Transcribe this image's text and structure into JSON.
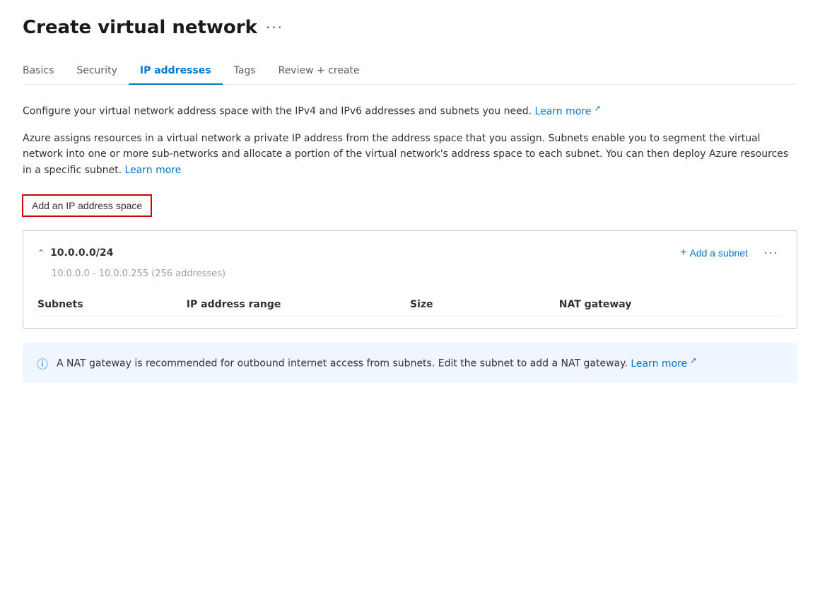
{
  "page": {
    "title": "Create virtual network",
    "more_label": "···"
  },
  "tabs": [
    {
      "id": "basics",
      "label": "Basics",
      "active": false
    },
    {
      "id": "security",
      "label": "Security",
      "active": false
    },
    {
      "id": "ip-addresses",
      "label": "IP addresses",
      "active": true
    },
    {
      "id": "tags",
      "label": "Tags",
      "active": false
    },
    {
      "id": "review-create",
      "label": "Review + create",
      "active": false
    }
  ],
  "description1": "Configure your virtual network address space with the IPv4 and IPv6 addresses and subnets you need.",
  "description1_learn_more": "Learn more",
  "description2": "Azure assigns resources in a virtual network a private IP address from the address space that you assign. Subnets enable you to segment the virtual network into one or more sub-networks and allocate a portion of the virtual network's address space to each subnet. You can then deploy Azure resources in a specific subnet.",
  "description2_learn_more": "Learn more",
  "add_ip_btn_label": "Add an IP address space",
  "ip_space": {
    "cidr": "10.0.0.0/24",
    "range_text": "10.0.0.0 - 10.0.0.255 (256 addresses)",
    "add_subnet_label": "Add a subnet",
    "more_label": "···",
    "table": {
      "columns": [
        "Subnets",
        "IP address range",
        "Size",
        "NAT gateway"
      ],
      "rows": []
    }
  },
  "info_banner": {
    "text": "A NAT gateway is recommended for outbound internet access from subnets. Edit the subnet to add a NAT gateway.",
    "learn_more_label": "Learn more"
  }
}
